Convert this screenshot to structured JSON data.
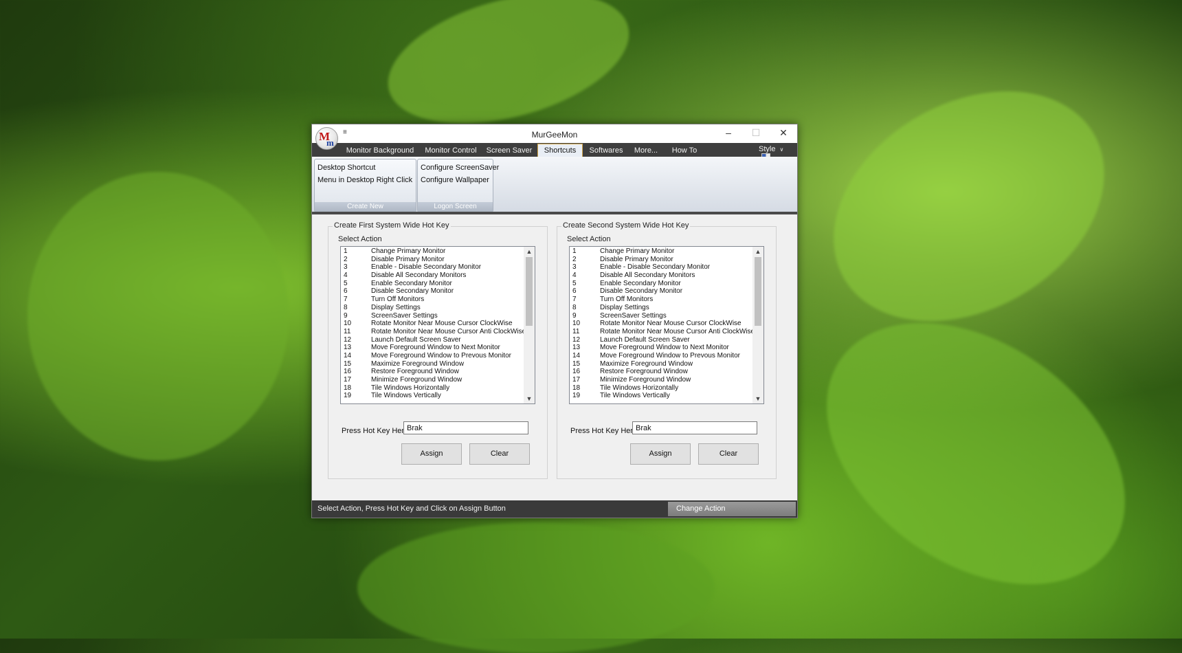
{
  "window": {
    "title": "MurGeeMon",
    "minimize": "–",
    "maximize": "☐",
    "close": "✕",
    "qat": "≡"
  },
  "logo": {
    "m_large": "M",
    "m_small": "m"
  },
  "tabs": [
    "Monitor Background",
    "Monitor Control",
    "Screen Saver",
    "Shortcuts",
    "Softwares",
    "More...",
    "How To"
  ],
  "active_tab": "Shortcuts",
  "style_menu": "Style",
  "ribbon": {
    "create_new": {
      "caption": "Create New",
      "items": [
        "Desktop Shortcut",
        "Menu in Desktop Right Click"
      ]
    },
    "logon_screen": {
      "caption": "Logon Screen",
      "items": [
        "Configure ScreenSaver",
        "Configure Wallpaper"
      ]
    }
  },
  "actions": [
    {
      "num": "1",
      "label": "Change Primary Monitor"
    },
    {
      "num": "2",
      "label": "Disable Primary Monitor"
    },
    {
      "num": "3",
      "label": "Enable - Disable Secondary Monitor"
    },
    {
      "num": "4",
      "label": "Disable All Secondary Monitors"
    },
    {
      "num": "5",
      "label": "Enable Secondary Monitor"
    },
    {
      "num": "6",
      "label": "Disable Secondary Monitor"
    },
    {
      "num": "7",
      "label": "Turn Off Monitors"
    },
    {
      "num": "8",
      "label": "Display Settings"
    },
    {
      "num": "9",
      "label": "ScreenSaver Settings"
    },
    {
      "num": "10",
      "label": "Rotate Monitor Near Mouse Cursor ClockWise"
    },
    {
      "num": "11",
      "label": "Rotate Monitor Near Mouse Cursor Anti ClockWise"
    },
    {
      "num": "12",
      "label": "Launch Default Screen Saver"
    },
    {
      "num": "13",
      "label": "Move Foreground Window to Next Monitor"
    },
    {
      "num": "14",
      "label": "Move Foreground Window to Prevous Monitor"
    },
    {
      "num": "15",
      "label": "Maximize Foreground Window"
    },
    {
      "num": "16",
      "label": "Restore Foreground Window"
    },
    {
      "num": "17",
      "label": "Minimize Foreground Window"
    },
    {
      "num": "18",
      "label": "Tile Windows Horizontally"
    },
    {
      "num": "19",
      "label": "Tile Windows Vertically"
    }
  ],
  "hotkey1": {
    "group_title": "Create First System Wide Hot Key",
    "select_label": "Select Action",
    "press_label": "Press Hot Key Here",
    "value": "Brak",
    "assign": "Assign",
    "clear": "Clear"
  },
  "hotkey2": {
    "group_title": "Create Second System Wide Hot Key",
    "select_label": "Select Action",
    "press_label": "Press Hot Key Here",
    "value": "Brak",
    "assign": "Assign",
    "clear": "Clear"
  },
  "status": {
    "text": "Select Action, Press Hot Key and Click on Assign Button",
    "change_action": "Change Action"
  }
}
